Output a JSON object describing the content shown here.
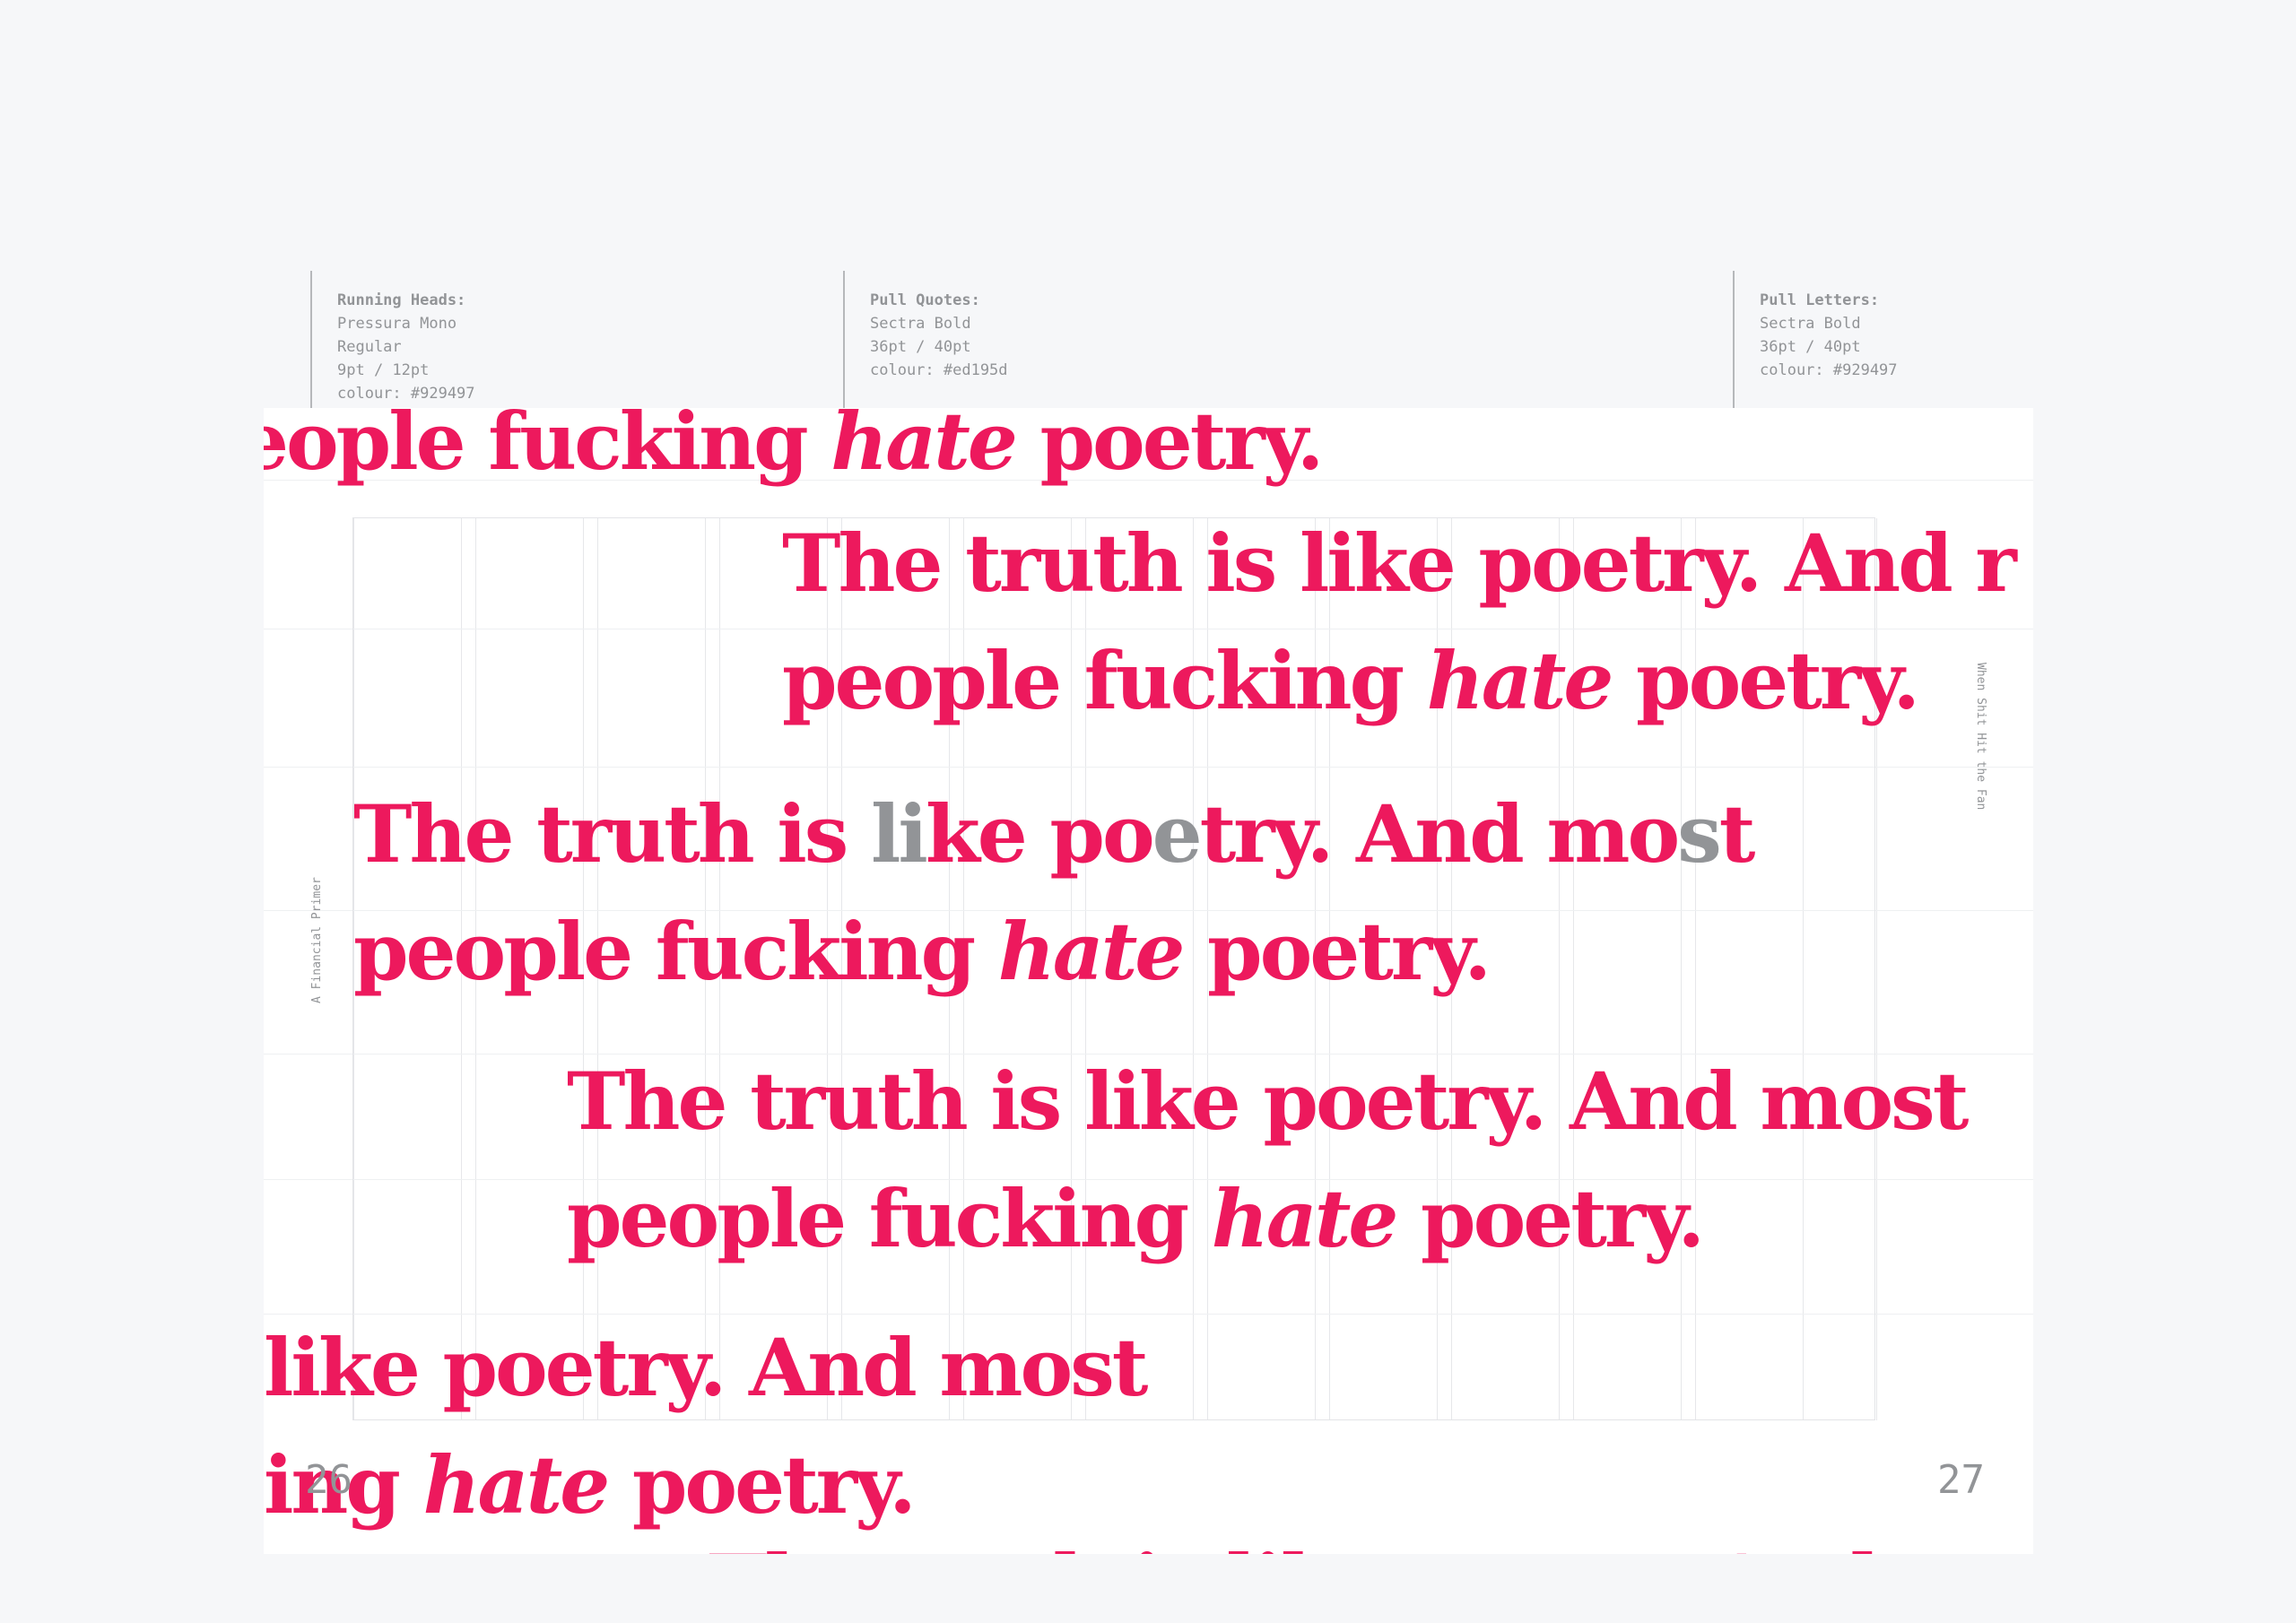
{
  "annotations": [
    {
      "label": "Running Heads:",
      "lines": "Pressura Mono\nRegular\n9pt / 12pt\ncolour: #929497"
    },
    {
      "label": "Pull Quotes:",
      "lines": "Sectra Bold\n36pt / 40pt\ncolour: #ed195d"
    },
    {
      "label": "Pull Letters:",
      "lines": "Sectra Bold\n36pt / 40pt\ncolour: #929497"
    }
  ],
  "quote": {
    "line1": "The truth is like poetry. And most",
    "line2_a": "people fucking ",
    "line2_italic": "hate",
    "line2_b": " poetry.",
    "top_fragment_a": "eople fucking ",
    "top_fragment_b": " poetry.",
    "main_line1_parts": [
      "The truth is ",
      "li",
      "ke po",
      "e",
      "try. And mo",
      "s",
      "t"
    ],
    "right_line1": "The truth is like poetry. And r",
    "bottom_line1": " like poetry. And most",
    "bottom_line2_a": "ing ",
    "bottom_line2_b": " poetry.",
    "cut_line": "The truth is like poetry. And"
  },
  "running_heads": {
    "left": "A Financial Primer",
    "right": "When Shit Hit the Fan"
  },
  "page_numbers": {
    "left": "26",
    "right": "27"
  },
  "colors": {
    "quote": "#ed195d",
    "grey": "#929497",
    "background": "#f6f7f9"
  }
}
